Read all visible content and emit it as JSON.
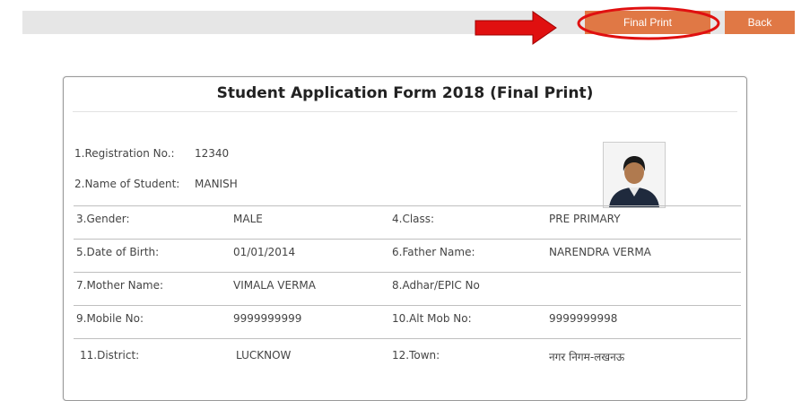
{
  "toolbar": {
    "final_print_label": "Final Print",
    "back_label": "Back"
  },
  "form": {
    "title": "Student Application Form 2018 (Final Print)",
    "registration_label": "1.Registration No.:",
    "registration_value": "12340",
    "name_label": "2.Name of Student:",
    "name_value": "MANISH",
    "rows": [
      {
        "l1": "3.Gender:",
        "v1": "MALE",
        "l2": "4.Class:",
        "v2": "PRE PRIMARY"
      },
      {
        "l1": "5.Date of Birth:",
        "v1": "01/01/2014",
        "l2": "6.Father Name:",
        "v2": "NARENDRA VERMA"
      },
      {
        "l1": "7.Mother Name:",
        "v1": "VIMALA VERMA",
        "l2": "8.Adhar/EPIC No",
        "v2": ""
      },
      {
        "l1": "9.Mobile No:",
        "v1": "9999999999",
        "l2": "10.Alt Mob No:",
        "v2": "9999999998"
      },
      {
        "l1": "11.District:",
        "v1": "LUCKNOW",
        "l2": "12.Town:",
        "v2": "नगर निगम-लखनऊ"
      }
    ]
  },
  "colors": {
    "button": "#e07845",
    "highlight": "#e01010",
    "toolbar_bg": "#e6e6e6"
  },
  "icons": {
    "arrow": "red-arrow-icon",
    "photo": "student-photo"
  }
}
